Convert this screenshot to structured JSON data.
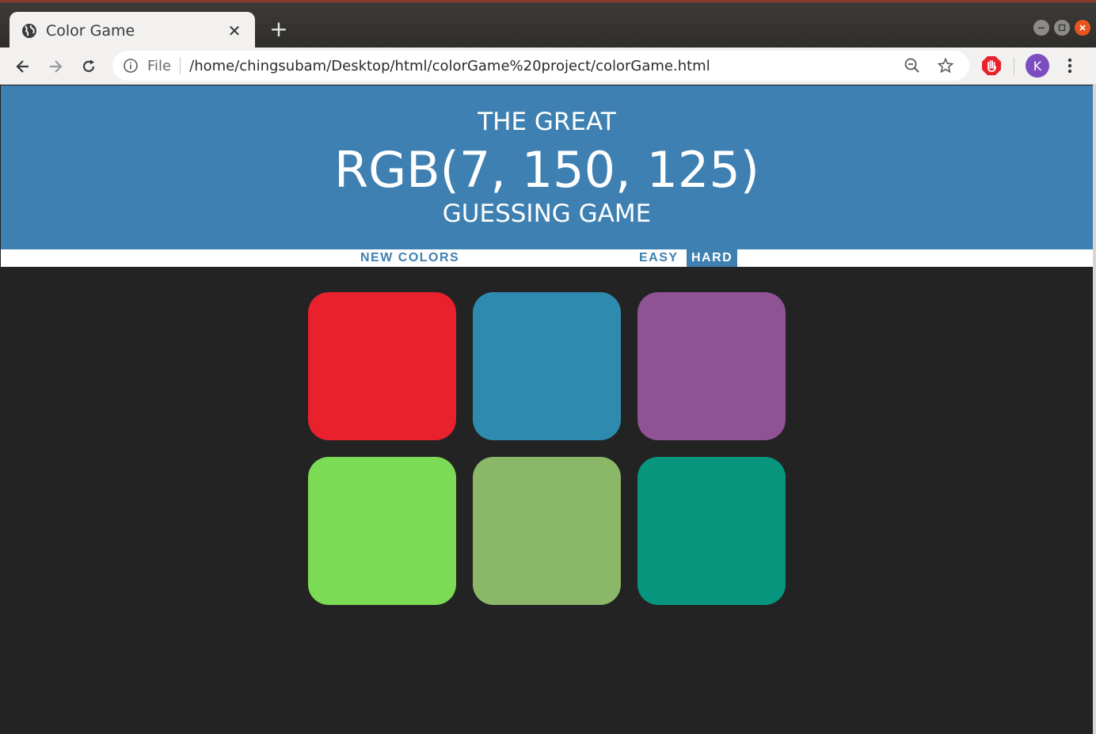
{
  "browser": {
    "tab_title": "Color Game",
    "tab_close": "✕",
    "new_tab": "+",
    "scheme_label": "File",
    "url": "/home/chingsubam/Desktop/html/colorGame%20project/colorGame.html",
    "profile_initial": "K",
    "window_controls": [
      "minimize",
      "maximize",
      "close"
    ]
  },
  "game": {
    "title_top": "THE GREAT",
    "rgb_display": "RGB(7, 150, 125)",
    "title_bottom": "GUESSING GAME",
    "new_colors_label": "NEW COLORS",
    "easy_label": "EASY",
    "hard_label": "HARD",
    "selected_mode": "HARD",
    "header_color": "#3e80b1",
    "background_color": "#232323",
    "squares": [
      {
        "color": "#e8212c"
      },
      {
        "color": "#2e8baf"
      },
      {
        "color": "#8e5295"
      },
      {
        "color": "#7cdb55"
      },
      {
        "color": "#8ab768"
      },
      {
        "color": "#07967d"
      }
    ]
  }
}
